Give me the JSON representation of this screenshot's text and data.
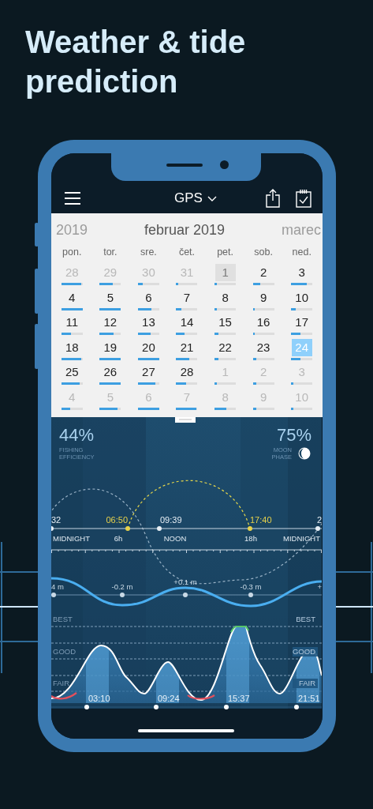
{
  "headline": "Weather & tide prediction",
  "nav": {
    "location": "GPS"
  },
  "calendar": {
    "prev_month": "2019",
    "month": "februar 2019",
    "next_month": "marec",
    "weekdays": [
      "pon.",
      "tor.",
      "sre.",
      "čet.",
      "pet.",
      "sob.",
      "ned."
    ],
    "weeks": [
      [
        {
          "day": "28",
          "kind": "outside",
          "level": 0.95,
          "selected": false
        },
        {
          "day": "29",
          "kind": "outside",
          "level": 0.6,
          "selected": false
        },
        {
          "day": "30",
          "kind": "outside",
          "level": 0.22,
          "selected": false
        },
        {
          "day": "31",
          "kind": "outside",
          "level": 0.1,
          "selected": false
        },
        {
          "day": "1",
          "kind": "shaded",
          "level": 0.1,
          "selected": false
        },
        {
          "day": "2",
          "kind": "inside",
          "level": 0.33,
          "selected": false
        },
        {
          "day": "3",
          "kind": "inside",
          "level": 0.75,
          "selected": false
        }
      ],
      [
        {
          "day": "4",
          "kind": "inside",
          "level": 1,
          "selected": false
        },
        {
          "day": "5",
          "kind": "inside",
          "level": 1,
          "selected": false
        },
        {
          "day": "6",
          "kind": "inside",
          "level": 0.65,
          "selected": false
        },
        {
          "day": "7",
          "kind": "inside",
          "level": 0.25,
          "selected": false
        },
        {
          "day": "8",
          "kind": "inside",
          "level": 0.1,
          "selected": false
        },
        {
          "day": "9",
          "kind": "inside",
          "level": 0.1,
          "selected": false
        },
        {
          "day": "10",
          "kind": "inside",
          "level": 0.2,
          "selected": false
        }
      ],
      [
        {
          "day": "11",
          "kind": "inside",
          "level": 0.45,
          "selected": false
        },
        {
          "day": "12",
          "kind": "inside",
          "level": 0.65,
          "selected": false
        },
        {
          "day": "13",
          "kind": "inside",
          "level": 0.6,
          "selected": false
        },
        {
          "day": "14",
          "kind": "inside",
          "level": 0.4,
          "selected": false
        },
        {
          "day": "15",
          "kind": "inside",
          "level": 0.2,
          "selected": false
        },
        {
          "day": "16",
          "kind": "inside",
          "level": 0.1,
          "selected": false
        },
        {
          "day": "17",
          "kind": "inside",
          "level": 0.45,
          "selected": false
        }
      ],
      [
        {
          "day": "18",
          "kind": "inside",
          "level": 0.95,
          "selected": false
        },
        {
          "day": "19",
          "kind": "inside",
          "level": 1,
          "selected": false
        },
        {
          "day": "20",
          "kind": "inside",
          "level": 1,
          "selected": false
        },
        {
          "day": "21",
          "kind": "inside",
          "level": 0.6,
          "selected": false
        },
        {
          "day": "22",
          "kind": "inside",
          "level": 0.2,
          "selected": false
        },
        {
          "day": "23",
          "kind": "inside",
          "level": 0.15,
          "selected": false
        },
        {
          "day": "24",
          "kind": "inside",
          "level": 0.45,
          "selected": true
        }
      ],
      [
        {
          "day": "25",
          "kind": "inside",
          "level": 0.85,
          "selected": false
        },
        {
          "day": "26",
          "kind": "inside",
          "level": 1,
          "selected": false
        },
        {
          "day": "27",
          "kind": "inside",
          "level": 0.8,
          "selected": false
        },
        {
          "day": "28",
          "kind": "inside",
          "level": 0.45,
          "selected": false
        },
        {
          "day": "1",
          "kind": "outside",
          "level": 0.1,
          "selected": false
        },
        {
          "day": "2",
          "kind": "outside",
          "level": 0.15,
          "selected": false
        },
        {
          "day": "3",
          "kind": "outside",
          "level": 0.1,
          "selected": false
        }
      ],
      [
        {
          "day": "4",
          "kind": "outside",
          "level": 0.4,
          "selected": false
        },
        {
          "day": "5",
          "kind": "outside",
          "level": 0.85,
          "selected": false
        },
        {
          "day": "6",
          "kind": "outside",
          "level": 1,
          "selected": false
        },
        {
          "day": "7",
          "kind": "outside",
          "level": 0.95,
          "selected": false
        },
        {
          "day": "8",
          "kind": "outside",
          "level": 0.55,
          "selected": false
        },
        {
          "day": "9",
          "kind": "outside",
          "level": 0.15,
          "selected": false
        },
        {
          "day": "10",
          "kind": "outside",
          "level": 0.1,
          "selected": false
        }
      ]
    ]
  },
  "summary": {
    "efficiency": "44%",
    "efficiency_label": "FISHING EFFICIENCY",
    "moon": "75%",
    "moon_label": "MOON PHASE"
  },
  "sun_moon": {
    "times": [
      {
        "text": "32",
        "kind": "moon"
      },
      {
        "text": "06:50",
        "kind": "sun"
      },
      {
        "text": "09:39",
        "kind": "moon"
      },
      {
        "text": "17:40",
        "kind": "sun"
      },
      {
        "text": "2",
        "kind": "moon"
      }
    ],
    "hours": [
      "MIDNIGHT",
      "6h",
      "NOON",
      "18h",
      "MIDNIGHT"
    ]
  },
  "tide": {
    "heights": [
      "4 m",
      "-0.2 m",
      "+0.1 m",
      "-0.3 m",
      "+"
    ]
  },
  "activity": {
    "levels_left": [
      "BEST",
      "GOOD",
      "FAIR"
    ],
    "levels_right": [
      "BEST",
      "GOOD",
      "FAIR"
    ],
    "peaks": [
      "03:10",
      "09:24",
      "15:37",
      "21:51"
    ]
  }
}
